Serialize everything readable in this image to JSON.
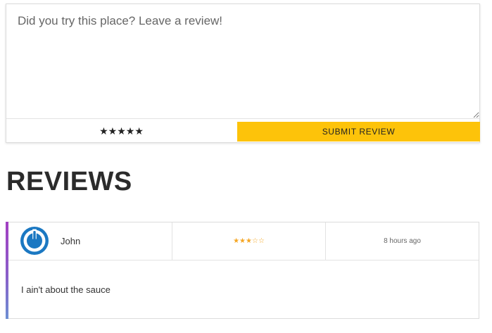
{
  "form": {
    "placeholder": "Did you try this place? Leave a review!",
    "star_picker": "★★★★★",
    "submit_label": "SUBMIT REVIEW",
    "accent_color": "#fdc30a"
  },
  "reviews_section": {
    "title": "REVIEWS"
  },
  "reviews": [
    {
      "avatar_icon": "power-icon",
      "name": "John",
      "rating_display": "★★★☆☆",
      "rating": 3,
      "time_ago": "8 hours ago",
      "text": "I ain't about the sauce"
    }
  ]
}
